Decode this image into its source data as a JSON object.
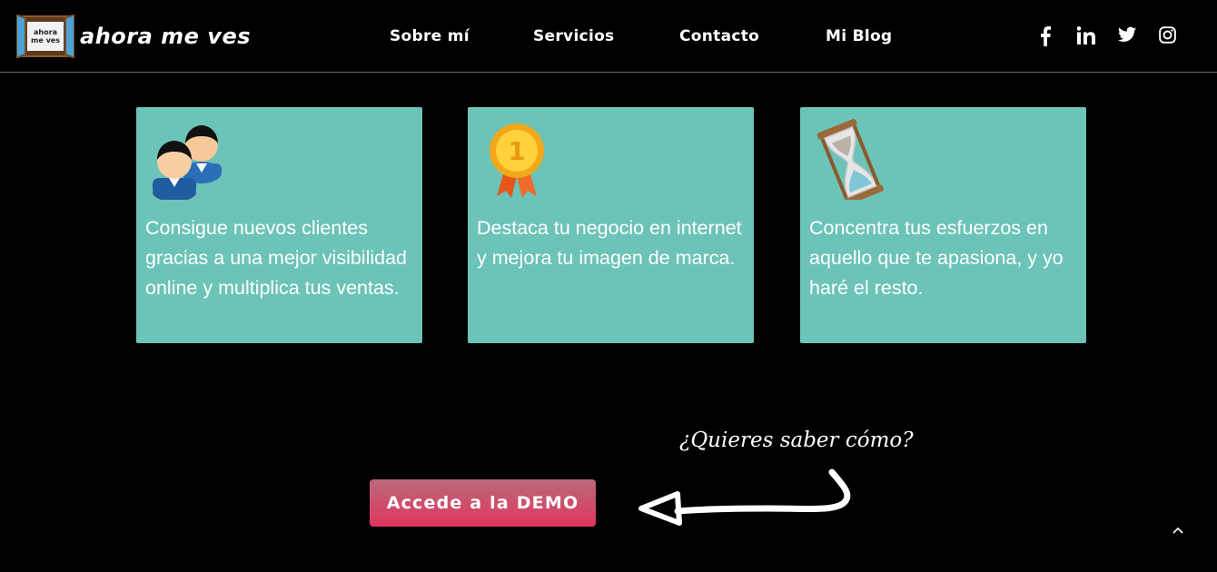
{
  "brand": {
    "name": "ahora me ves",
    "window_text": "ahora me ves"
  },
  "nav": [
    {
      "label": "Sobre mí"
    },
    {
      "label": "Servicios"
    },
    {
      "label": "Contacto"
    },
    {
      "label": "Mi Blog"
    }
  ],
  "social": [
    "facebook-icon",
    "linkedin-icon",
    "twitter-icon",
    "instagram-icon"
  ],
  "cards": [
    {
      "icon": "users-icon",
      "text": "Consigue nuevos clientes gracias a una mejor visibilidad online y multiplica tus ventas."
    },
    {
      "icon": "medal-icon",
      "text": "Destaca tu negocio en internet y mejora tu imagen de marca."
    },
    {
      "icon": "hourglass-icon",
      "text": "Concentra tus esfuerzos en aquello que te apasiona, y yo haré el resto."
    }
  ],
  "cta": {
    "question": "¿Quieres saber cómo?",
    "button": "Accede a la DEMO"
  },
  "colors": {
    "card": "#6cc3b7",
    "button_top": "#b86a7a",
    "button_bottom": "#e2365f",
    "background": "#000000"
  }
}
